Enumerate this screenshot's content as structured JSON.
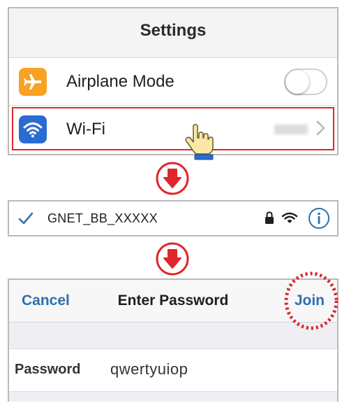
{
  "settings": {
    "title": "Settings",
    "rows": [
      {
        "label": "Airplane Mode",
        "icon": "airplane-icon",
        "icon_color": "#f7a223",
        "toggle_on": false
      },
      {
        "label": "Wi-Fi",
        "icon": "wifi-icon",
        "icon_color": "#2a6cd1",
        "highlighted": true,
        "highlight_color": "#e0252b"
      }
    ]
  },
  "arrows": {
    "icon": "arrow-down-icon",
    "color": "#e0252b"
  },
  "network": {
    "name": "GNET_BB_XXXXX",
    "connected": true,
    "icons": [
      "checkmark-icon",
      "lock-icon",
      "wifi-icon",
      "info-icon"
    ]
  },
  "password_dialog": {
    "cancel_label": "Cancel",
    "title": "Enter Password",
    "join_label": "Join",
    "field_label": "Password",
    "field_value": "qwertyuiop",
    "accent_color": "#2e6fad"
  }
}
